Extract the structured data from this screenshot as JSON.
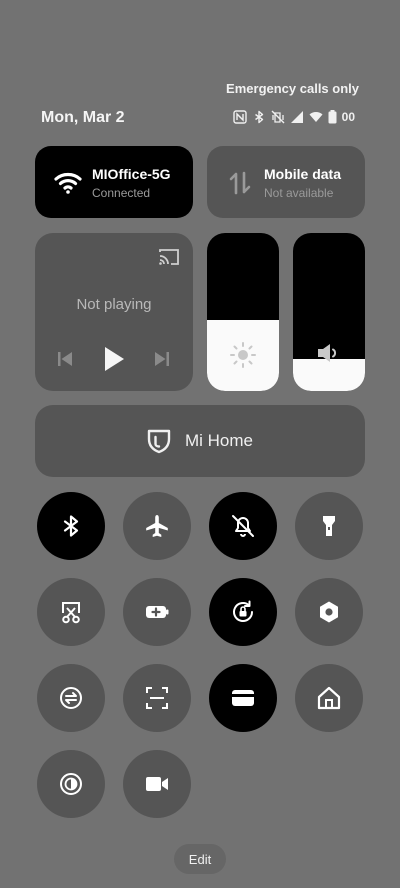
{
  "status": {
    "carrier_text": "Emergency calls only",
    "date": "Mon, Mar 2",
    "battery_text": "00",
    "icons": [
      "nfc-icon",
      "bluetooth-icon",
      "mute-vibrate-icon",
      "signal-icon",
      "wifi-icon",
      "battery-icon"
    ]
  },
  "wifi": {
    "title": "MIOffice-5G",
    "subtitle": "Connected",
    "active": true
  },
  "mobile": {
    "title": "Mobile data",
    "subtitle": "Not available",
    "active": false
  },
  "media": {
    "status": "Not playing"
  },
  "brightness": {
    "level": 0.45
  },
  "volume": {
    "level": 0.2
  },
  "mihome": {
    "label": "Mi Home"
  },
  "toggles": [
    {
      "name": "bluetooth",
      "icon": "bluetooth-icon",
      "active": true
    },
    {
      "name": "airplane-mode",
      "icon": "airplane-icon",
      "active": false
    },
    {
      "name": "mute",
      "icon": "bell-off-icon",
      "active": true
    },
    {
      "name": "flashlight",
      "icon": "flashlight-icon",
      "active": false
    },
    {
      "name": "screenshot",
      "icon": "scissors-icon",
      "active": false
    },
    {
      "name": "battery-saver",
      "icon": "battery-plus-icon",
      "active": false
    },
    {
      "name": "lock-rotation",
      "icon": "rotation-lock-icon",
      "active": true
    },
    {
      "name": "settings",
      "icon": "hexagon-gear-icon",
      "active": false
    },
    {
      "name": "sync",
      "icon": "sync-icon",
      "active": false
    },
    {
      "name": "scanner",
      "icon": "scan-icon",
      "active": false
    },
    {
      "name": "wallet",
      "icon": "card-icon",
      "active": true
    },
    {
      "name": "home",
      "icon": "home-icon",
      "active": false
    },
    {
      "name": "reading-mode",
      "icon": "contrast-icon",
      "active": false
    },
    {
      "name": "screen-recorder",
      "icon": "video-camera-icon",
      "active": false
    }
  ],
  "edit_label": "Edit",
  "colors": {
    "background": "#727272",
    "tile": "#555555",
    "active": "#000000",
    "slider_fill": "#fafafa"
  }
}
